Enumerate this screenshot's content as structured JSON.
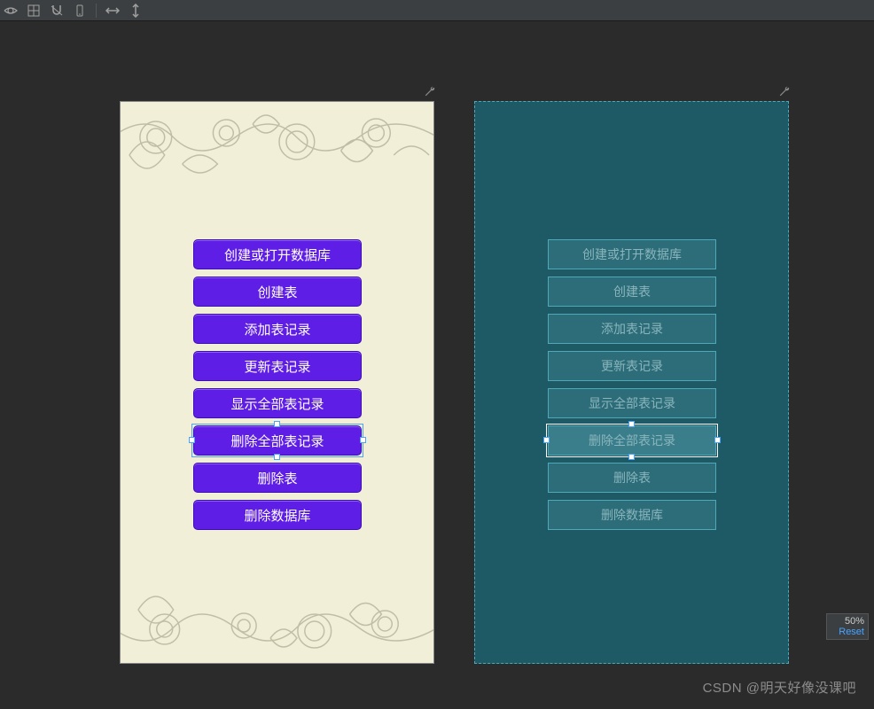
{
  "toolbar": {
    "icons": [
      "eye",
      "grid",
      "cut",
      "bound",
      "harrow",
      "varrow"
    ]
  },
  "buttons": {
    "b0": "创建或打开数据库",
    "b1": "创建表",
    "b2": "添加表记录",
    "b3": "更新表记录",
    "b4": "显示全部表记录",
    "b5": "删除全部表记录",
    "b6": "删除表",
    "b7": "删除数据库"
  },
  "zoom": {
    "value": "50%",
    "reset": "Reset"
  },
  "watermark": "CSDN @明天好像没课吧"
}
